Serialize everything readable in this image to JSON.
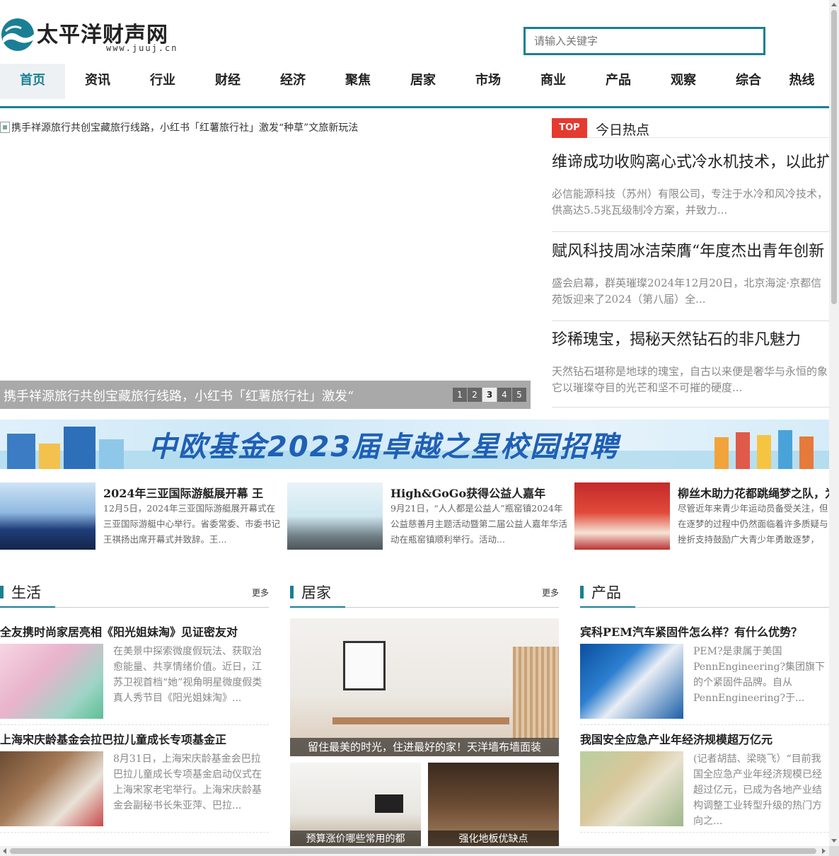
{
  "site": {
    "name": "太平洋财声网",
    "url": "www.juuj.cn"
  },
  "search": {
    "placeholder": "请输入关键字"
  },
  "nav": [
    "首页",
    "资讯",
    "行业",
    "财经",
    "经济",
    "聚焦",
    "居家",
    "市场",
    "商业",
    "产品",
    "观察",
    "综合",
    "热线"
  ],
  "carousel": {
    "alt_text": "携手祥源旅行共创宝藏旅行线路，小红书「红薯旅行社」激发“种草”文旅新玩法",
    "caption": "携手祥源旅行共创宝藏旅行线路，小红书「红薯旅行社」激发“",
    "pages": [
      "1",
      "2",
      "3",
      "4",
      "5"
    ],
    "active_page": "3"
  },
  "hot": {
    "badge": "TOP",
    "title": "今日热点",
    "items": [
      {
        "title": "维谛成功收购离心式冷水机技术，以此扩",
        "desc": "必信能源科技（苏州）有限公司，专注于水冷和风冷技术，供高达5.5兆瓦级制冷方案，并致力..."
      },
      {
        "title": "赋风科技周冰洁荣膺“年度杰出青年创新",
        "desc": "盛会启幕，群英璀璨2024年12月20日，北京海淀·京都信苑饭迎来了2024（第八届）全..."
      },
      {
        "title": "珍稀瑰宝，揭秘天然钻石的非凡魅力",
        "desc": "天然钻石堪称是地球的瑰宝，自古以来便是奢华与永恒的象它以璀璨夺目的光芒和坚不可摧的硬度..."
      }
    ]
  },
  "banner": {
    "text": "中欧基金2023届卓越之星校园招聘"
  },
  "news": [
    {
      "title": "2024年三亚国际游艇展开幕 王",
      "desc": "12月5日，2024年三亚国际游艇展开幕式在三亚国际游艇中心举行。省委常委、市委书记王祺扬出席开幕式并致辞。王..."
    },
    {
      "title": "High&GoGo获得公益人嘉年",
      "desc": "9月21日，“人人都是公益人”瓶窑镇2024年公益慈善月主题活动暨第二届公益人嘉年华活动在瓶窑镇顺利举行。活动..."
    },
    {
      "title": "柳丝木助力花都跳绳梦之队，为少",
      "desc": "尽管近年来青少年运动员备受关注，但在逐梦的过程中仍然面临着许多质疑与挫折支持鼓励广大青少年勇敢逐梦，柳..."
    }
  ],
  "sections": {
    "life": {
      "title": "生活",
      "more": "更多",
      "items": [
        {
          "title": "全友携时尚家居亮相《阳光姐妹淘》见证密友对",
          "desc": "在美景中探索微度假玩法、获取治愈能量、共享情绪价值。近日，江苏卫视首档“她”视角明星微度假类真人秀节目《阳光姐妹淘》..."
        },
        {
          "title": "上海宋庆龄基金会拉巴拉儿童成长专项基金正",
          "desc": "8月31日，上海宋庆龄基金会巴拉巴拉儿童成长专项基金启动仪式在上海宋家老宅举行。上海宋庆龄基金会副秘书长朱亚萍、巴拉..."
        }
      ]
    },
    "home": {
      "title": "居家",
      "more": "更多",
      "main_caption": "留住最美的时光，住进最好的家！天洋墙布墙面装",
      "small": [
        {
          "caption": "预算涨价哪些常用的都"
        },
        {
          "caption": "强化地板优缺点"
        }
      ]
    },
    "product": {
      "title": "产品",
      "items": [
        {
          "title": "宾科PEM汽车紧固件怎么样？有什么优势？",
          "desc": "PEM?是隶属于美国PennEngineering?集团旗下的个紧固件品牌。自从PennEngineering?于..."
        },
        {
          "title": "我国安全应急产业年经济规模超万亿元",
          "desc": "(记者胡喆、梁晓飞）“目前我国全应急产业年经济规模已经超过亿元，已成为各地产业结构调整工业转型升级的热门方向之..."
        }
      ]
    }
  }
}
